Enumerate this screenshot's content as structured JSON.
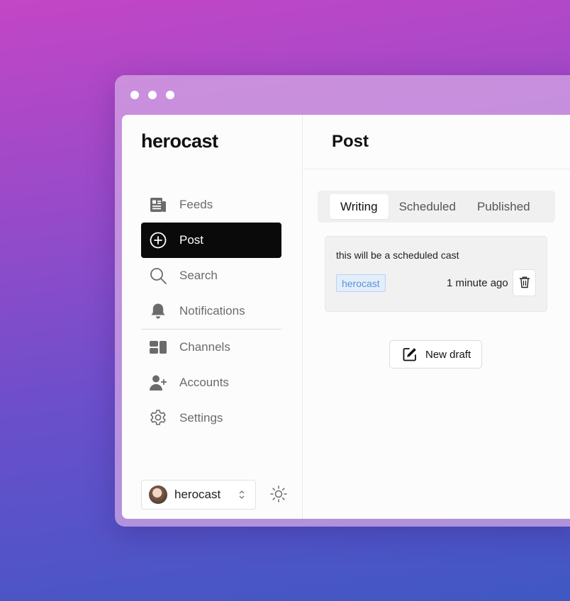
{
  "window": {
    "traffic_lights": [
      "close",
      "minimize",
      "maximize"
    ]
  },
  "sidebar": {
    "brand": "herocast",
    "items": [
      {
        "label": "Feeds",
        "icon": "newspaper-icon",
        "active": false
      },
      {
        "label": "Post",
        "icon": "plus-circle-icon",
        "active": true
      },
      {
        "label": "Search",
        "icon": "search-icon",
        "active": false
      },
      {
        "label": "Notifications",
        "icon": "bell-icon",
        "active": false
      },
      {
        "label": "Channels",
        "icon": "channels-icon",
        "active": false
      },
      {
        "label": "Accounts",
        "icon": "user-plus-icon",
        "active": false
      },
      {
        "label": "Settings",
        "icon": "gear-icon",
        "active": false
      }
    ],
    "account": {
      "name": "herocast",
      "avatar": "avatar",
      "toggle_icon": "chevron-up-down-icon"
    },
    "theme_toggle_icon": "sun-icon"
  },
  "main": {
    "title": "Post",
    "tabs": [
      {
        "label": "Writing",
        "active": true
      },
      {
        "label": "Scheduled",
        "active": false
      },
      {
        "label": "Published",
        "active": false
      }
    ],
    "drafts": [
      {
        "text": "this will be a scheduled cast",
        "channel": "herocast",
        "time": "1 minute ago"
      }
    ],
    "new_draft_label": "New draft"
  },
  "colors": {
    "active_nav_bg": "#0a0a0a",
    "channel_tag_text": "#5b92d6",
    "channel_tag_bg": "#e3eefb"
  }
}
